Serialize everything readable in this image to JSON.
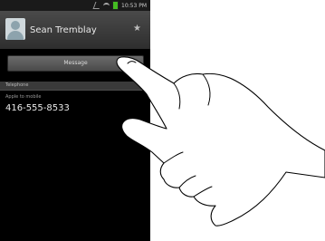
{
  "status_bar": {
    "time": "10:53 PM"
  },
  "header": {
    "contact_name": "Sean Tremblay"
  },
  "actions": {
    "message_label": "Message"
  },
  "phone_section": {
    "header_label": "Telephone",
    "tap_hint": "Apple to mobile",
    "number": "416-555-8533"
  }
}
